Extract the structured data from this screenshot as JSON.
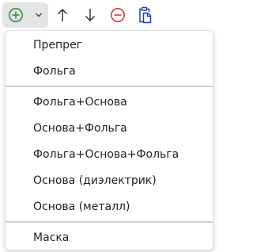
{
  "toolbar": {
    "buttons": [
      {
        "name": "add-layer",
        "icon": "plus-circle-icon",
        "color": "#2e8b3e",
        "has_dropdown": true,
        "pressed": true
      },
      {
        "name": "move-up",
        "icon": "arrow-up-icon",
        "color": "#333333"
      },
      {
        "name": "move-down",
        "icon": "arrow-down-icon",
        "color": "#333333"
      },
      {
        "name": "remove-layer",
        "icon": "minus-circle-icon",
        "color": "#d32f2f"
      },
      {
        "name": "paste-layers",
        "icon": "clipboard-doc-icon",
        "color": "#1f3fb5"
      }
    ]
  },
  "menu": {
    "items": [
      {
        "label": "Препрег"
      },
      {
        "label": "Фольга"
      },
      {
        "label": "Фольга+Основа"
      },
      {
        "label": "Основа+Фольга"
      },
      {
        "label": "Фольга+Основа+Фольга"
      },
      {
        "label": "Основа (диэлектрик)"
      },
      {
        "label": "Основа (металл)"
      },
      {
        "label": "Маска"
      }
    ]
  }
}
